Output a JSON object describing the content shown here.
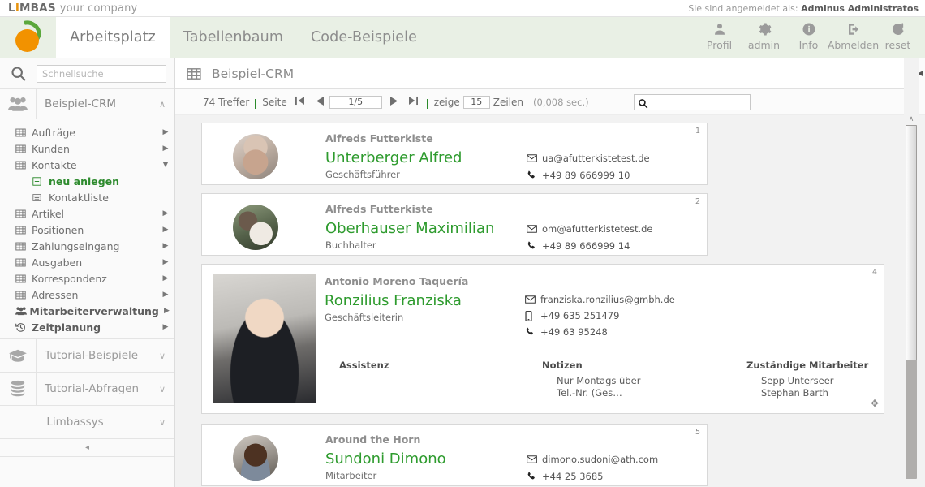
{
  "topbar": {
    "brand_l": "L",
    "brand_i": "I",
    "brand_rest": "MBAS",
    "brand_sub": "your company",
    "login_prefix": "Sie sind angemeldet als:",
    "login_user": "Adminus Administratos"
  },
  "header": {
    "tabs": [
      {
        "label": "Arbeitsplatz",
        "active": true
      },
      {
        "label": "Tabellenbaum",
        "active": false
      },
      {
        "label": "Code-Beispiele",
        "active": false
      }
    ],
    "tools": [
      {
        "label": "Profil",
        "icon": "user-icon"
      },
      {
        "label": "admin",
        "icon": "gear-icon"
      },
      {
        "label": "Info",
        "icon": "info-icon"
      },
      {
        "label": "Abmelden",
        "icon": "logout-icon"
      },
      {
        "label": "reset",
        "icon": "refresh-icon"
      }
    ]
  },
  "sidebar": {
    "search_placeholder": "Schnellsuche",
    "search_value": "",
    "group": {
      "label": "Beispiel-CRM",
      "icon": "group-users-icon",
      "chevron": "∧"
    },
    "tree": [
      {
        "label": "Aufträge",
        "icon": "table-icon",
        "arrow": "▶",
        "level": 0,
        "bold": false
      },
      {
        "label": "Kunden",
        "icon": "table-icon",
        "arrow": "▶",
        "level": 0,
        "bold": false
      },
      {
        "label": "Kontakte",
        "icon": "table-icon",
        "arrow": "▼",
        "level": 0,
        "bold": false
      },
      {
        "label": "neu anlegen",
        "icon": "plus-box-icon",
        "arrow": "",
        "level": 1,
        "bold": false,
        "green": true
      },
      {
        "label": "Kontaktliste",
        "icon": "list-box-icon",
        "arrow": "",
        "level": 1,
        "bold": false
      },
      {
        "label": "Artikel",
        "icon": "table-icon",
        "arrow": "▶",
        "level": 0,
        "bold": false
      },
      {
        "label": "Positionen",
        "icon": "table-icon",
        "arrow": "▶",
        "level": 0,
        "bold": false
      },
      {
        "label": "Zahlungseingang",
        "icon": "table-icon",
        "arrow": "▶",
        "level": 0,
        "bold": false
      },
      {
        "label": "Ausgaben",
        "icon": "table-icon",
        "arrow": "▶",
        "level": 0,
        "bold": false
      },
      {
        "label": "Korrespondenz",
        "icon": "table-icon",
        "arrow": "▶",
        "level": 0,
        "bold": false
      },
      {
        "label": "Adressen",
        "icon": "table-icon",
        "arrow": "▶",
        "level": 0,
        "bold": false
      },
      {
        "label": "Mitarbeiterverwaltung",
        "icon": "group-users-icon",
        "arrow": "▶",
        "level": 0,
        "bold": true
      },
      {
        "label": "Zeitplanung",
        "icon": "history-icon",
        "arrow": "▶",
        "level": 0,
        "bold": true
      }
    ],
    "bottom_groups": [
      {
        "label": "Tutorial-Beispiele",
        "icon": "graduation-cap-icon",
        "chevron": "∨"
      },
      {
        "label": "Tutorial-Abfragen",
        "icon": "database-icon",
        "chevron": "∨"
      },
      {
        "label": "Limbassys",
        "icon": "",
        "chevron": "∨"
      }
    ],
    "collapse_glyph": "◂"
  },
  "main": {
    "breadcrumb": {
      "title": "Beispiel-CRM",
      "icon": "table-icon"
    },
    "panel_handle_glyph": "◀",
    "toolbar": {
      "hits": "74 Treffer",
      "sep": "|",
      "page_label": "Seite",
      "first_glyph": "⏮",
      "prev_glyph": "◀",
      "page_value": "1/5",
      "next_glyph": "▶",
      "last_glyph": "⏭",
      "show_label": "zeige",
      "rows_value": "15",
      "rows_label": "Zeilen",
      "timing": "(0,008 sec.)",
      "search_value": "",
      "search_icon": "search-icon"
    },
    "cards": [
      {
        "num": "1",
        "company": "Alfreds Futterkiste",
        "name": "Unterberger Alfred",
        "role": "Geschäftsführer",
        "contacts": [
          {
            "icon": "mail-icon",
            "value": "ua@afutterkistetest.de"
          },
          {
            "icon": "phone-icon",
            "value": "+49 89 666999 10"
          }
        ],
        "photo": "f1",
        "large": false
      },
      {
        "num": "2",
        "company": "Alfreds Futterkiste",
        "name": "Oberhauser Maximilian",
        "role": "Buchhalter",
        "contacts": [
          {
            "icon": "mail-icon",
            "value": "om@afutterkistetest.de"
          },
          {
            "icon": "phone-icon",
            "value": "+49 89 666999 14"
          }
        ],
        "photo": "f2",
        "large": false
      },
      {
        "num": "4",
        "company": "Antonio Moreno Taquería",
        "name": "Ronzilius Franziska",
        "role": "Geschäftsleiterin",
        "contacts": [
          {
            "icon": "mail-icon",
            "value": "franziska.ronzilius@gmbh.de"
          },
          {
            "icon": "mobile-icon",
            "value": "+49 635 251479"
          },
          {
            "icon": "phone-icon",
            "value": "+49 63 95248"
          }
        ],
        "photo": "f3",
        "large": true,
        "sections": [
          {
            "head": "Assistenz",
            "lines": []
          },
          {
            "head": "Notizen",
            "lines": [
              "Nur Montags über",
              "Tel.-Nr. (Ges…"
            ]
          },
          {
            "head": "Zuständige Mitarbeiter",
            "lines": [
              "Sepp Unterseer",
              "Stephan Barth"
            ]
          }
        ],
        "move_glyph": "✥"
      },
      {
        "num": "5",
        "company": "Around the Horn",
        "name": "Sundoni Dimono",
        "role": "Mitarbeiter",
        "contacts": [
          {
            "icon": "mail-icon",
            "value": "dimono.sudoni@ath.com"
          },
          {
            "icon": "phone-icon",
            "value": "+44 25 3685"
          }
        ],
        "photo": "f4",
        "large": false
      }
    ]
  },
  "scrollbar": {
    "up_glyph": "∧"
  },
  "colors": {
    "accent_green": "#2e9b2e",
    "header_bg": "#e9f0e5",
    "brand_orange": "#e8940f",
    "muted_text": "#8c8c8c"
  }
}
